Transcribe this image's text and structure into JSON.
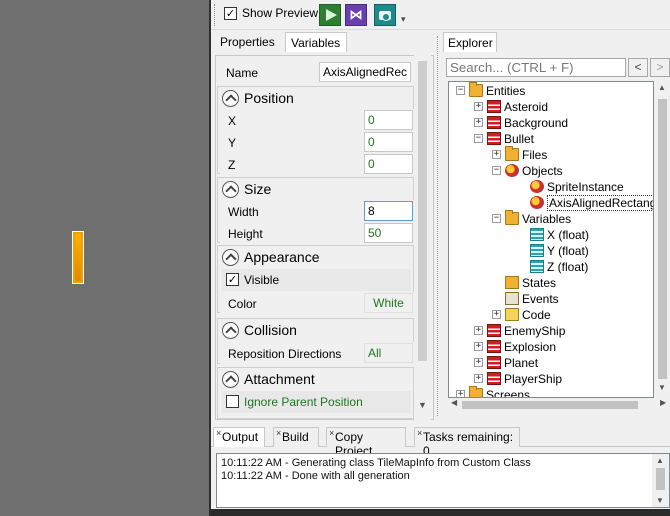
{
  "toolbar": {
    "show_preview_label": "Show Preview",
    "show_preview_checked": "✓",
    "play_icon": "play-icon",
    "vs_icon": "visual-studio-icon",
    "vs_glyph": "⋈",
    "camera_icon": "camera-icon",
    "overflow_glyph": "▾"
  },
  "properties": {
    "tabs": {
      "properties": "Properties",
      "variables": "Variables"
    },
    "name_label": "Name",
    "name_value": "AxisAlignedRec",
    "position": {
      "title": "Position",
      "x_label": "X",
      "x_value": "0",
      "y_label": "Y",
      "y_value": "0",
      "z_label": "Z",
      "z_value": "0"
    },
    "size": {
      "title": "Size",
      "width_label": "Width",
      "width_value": "8",
      "height_label": "Height",
      "height_value": "50"
    },
    "appearance": {
      "title": "Appearance",
      "visible_label": "Visible",
      "visible_checked": "✓",
      "color_label": "Color",
      "color_value": "White"
    },
    "collision": {
      "title": "Collision",
      "reposition_label": "Reposition Directions",
      "reposition_value": "All"
    },
    "attachment": {
      "title": "Attachment",
      "ignore_parent_label": "Ignore Parent Position"
    }
  },
  "explorer": {
    "tab": "Explorer",
    "search_placeholder": "Search... (CTRL + F)",
    "back_glyph": "<",
    "forward_glyph": ">",
    "tree": {
      "entities": "Entities",
      "asteroid": "Asteroid",
      "background": "Background",
      "bullet": "Bullet",
      "files": "Files",
      "objects": "Objects",
      "sprite_instance": "SpriteInstance",
      "axis_aligned_rectangle": "AxisAlignedRectangle",
      "variables": "Variables",
      "x_float": "X (float)",
      "y_float": "Y (float)",
      "z_float": "Z (float)",
      "states": "States",
      "events": "Events",
      "code": "Code",
      "enemy_ship": "EnemyShip",
      "explosion": "Explosion",
      "planet": "Planet",
      "player_ship": "PlayerShip",
      "screens": "Screens"
    },
    "expand_minus": "−",
    "expand_plus": "+"
  },
  "output": {
    "tabs": {
      "output": "Output",
      "build": "Build",
      "copy_project": "Copy Project",
      "tasks": "Tasks remaining: 0"
    },
    "close_glyph": "×",
    "lines": [
      "10:11:22 AM - Generating class TileMapInfo from Custom Class",
      "10:11:22 AM - Done with all generation"
    ]
  },
  "colors": {
    "accent_green_text": "#207520",
    "bullet_orange": "#f0a000",
    "preview_bg": "#6f6f6f"
  }
}
